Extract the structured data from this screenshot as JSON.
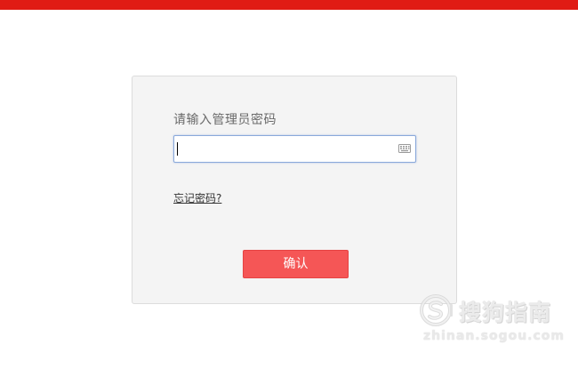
{
  "header": {
    "bar_color": "#e01b14"
  },
  "login": {
    "prompt": "请输入管理员密码",
    "password_value": "",
    "keyboard_icon": "keyboard-icon",
    "forgot_label": "忘记密码?",
    "confirm_label": "确认",
    "confirm_color": "#f55656"
  },
  "watermark": {
    "title": "搜狗指南",
    "url": "zhinan.sogou.com",
    "logo_icon": "sogou-logo-icon"
  }
}
